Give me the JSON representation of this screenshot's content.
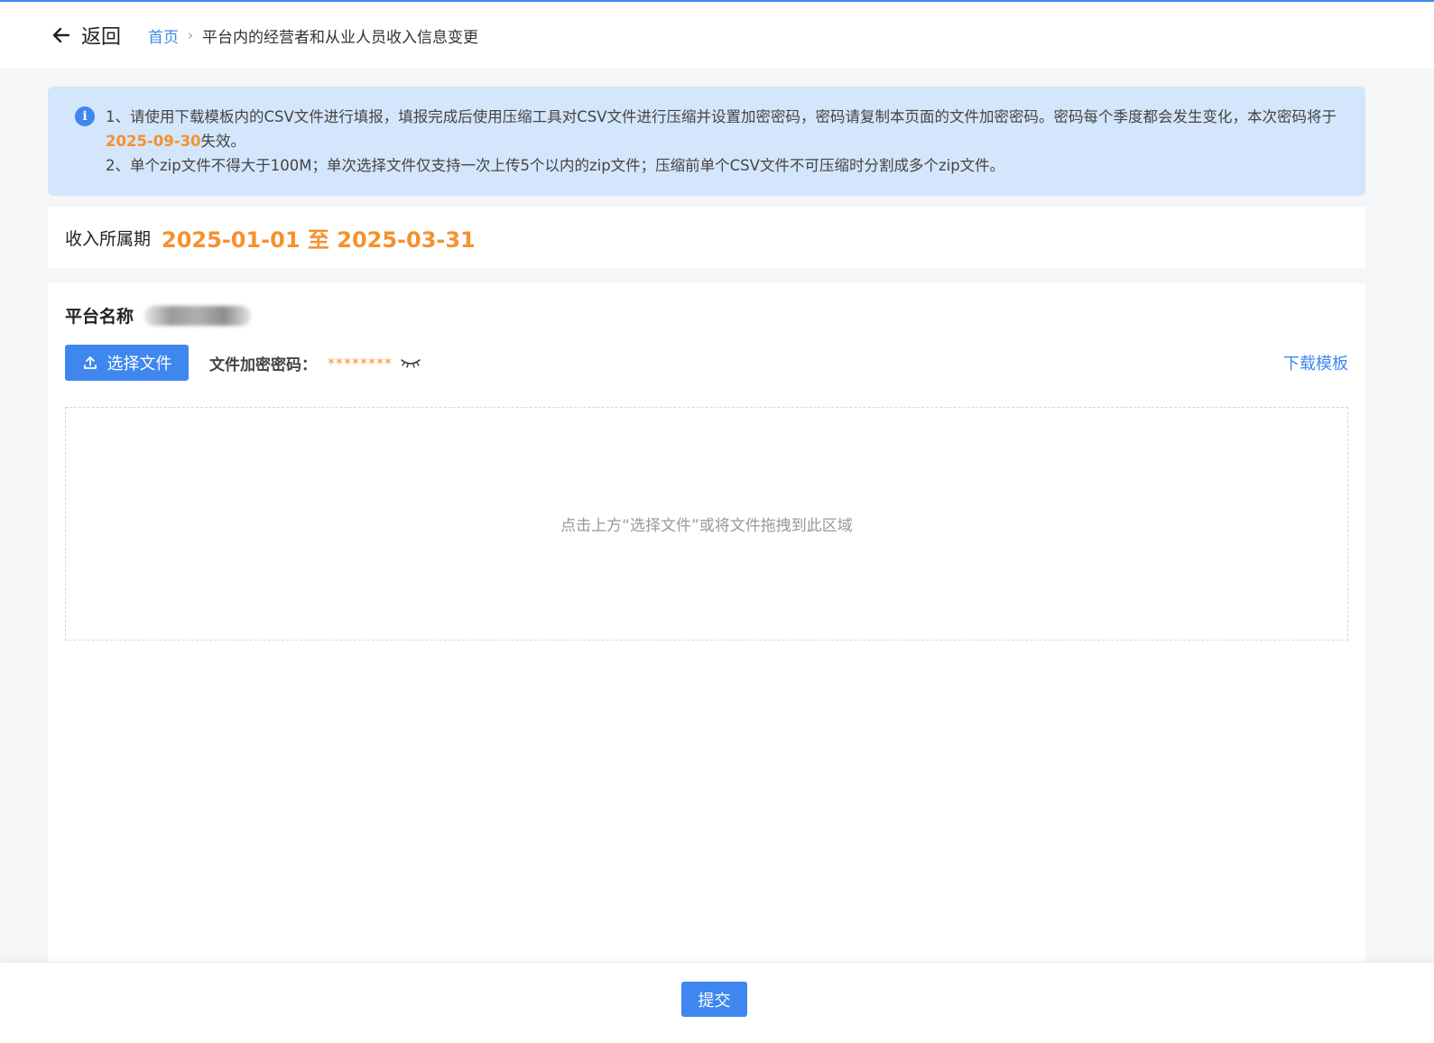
{
  "header": {
    "back_label": "返回",
    "breadcrumb": {
      "home": "首页",
      "separator": "›",
      "current": "平台内的经营者和从业人员收入信息变更"
    }
  },
  "notice": {
    "line1_prefix": "1、请使用下载模板内的CSV文件进行填报，填报完成后使用压缩工具对CSV文件进行压缩并设置加密密码，密码请复制本页面的文件加密密码。密码每个季度都会发生变化，本次密码将于",
    "expiry_date": "2025-09-30",
    "line1_suffix": "失效。",
    "line2": "2、单个zip文件不得大于100M；单次选择文件仅支持一次上传5个以内的zip文件；压缩前单个CSV文件不可压缩时分割成多个zip文件。"
  },
  "period": {
    "label": "收入所属期",
    "value": "2025-01-01 至 2025-03-31"
  },
  "platform": {
    "label": "平台名称"
  },
  "toolbar": {
    "upload_label": "选择文件",
    "password_label": "文件加密密码：",
    "password_masked": "********",
    "download_label": "下载模板"
  },
  "dropzone": {
    "hint": "点击上方“选择文件”或将文件拖拽到此区域"
  },
  "footer": {
    "submit_label": "提交"
  },
  "colors": {
    "primary": "#3f87ef",
    "highlight": "#f5912e",
    "notice_bg": "#d4e6fb"
  },
  "icons": {
    "back": "arrow-left-icon",
    "info": "info-icon",
    "upload": "upload-icon",
    "password_toggle": "eye-closed-icon"
  }
}
